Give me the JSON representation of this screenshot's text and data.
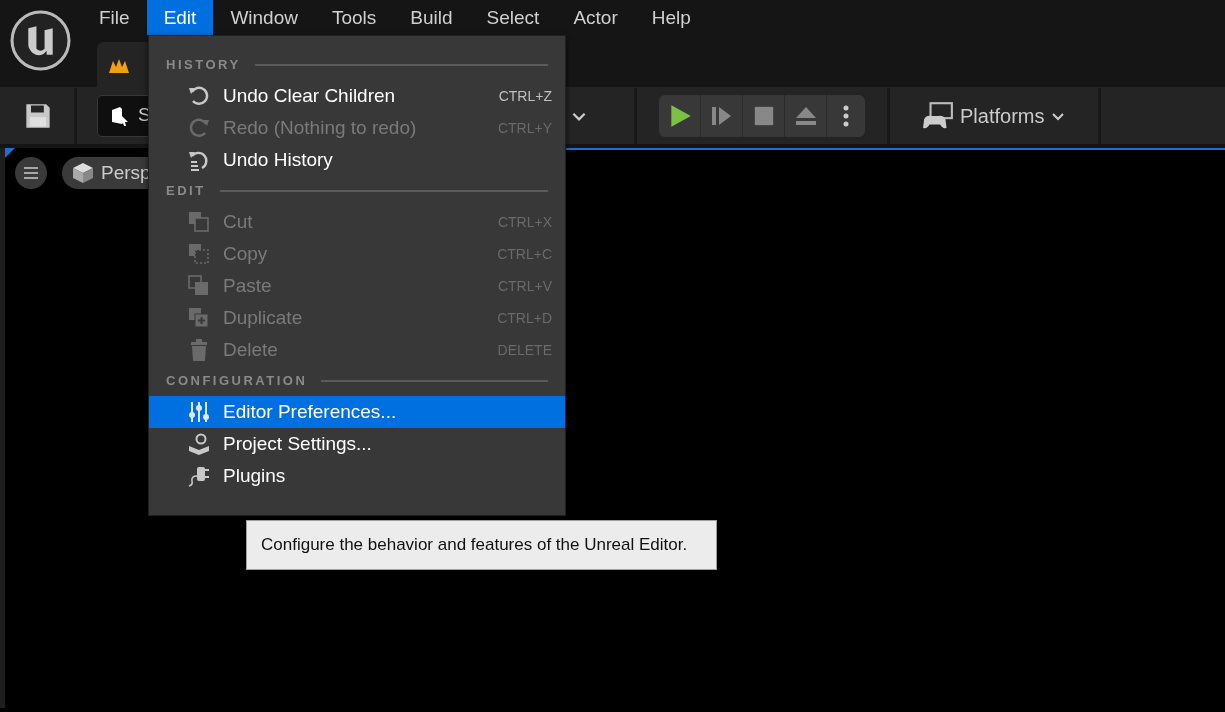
{
  "menubar": {
    "items": [
      {
        "label": "File",
        "selected": false
      },
      {
        "label": "Edit",
        "selected": true
      },
      {
        "label": "Window",
        "selected": false
      },
      {
        "label": "Tools",
        "selected": false
      },
      {
        "label": "Build",
        "selected": false
      },
      {
        "label": "Select",
        "selected": false
      },
      {
        "label": "Actor",
        "selected": false
      },
      {
        "label": "Help",
        "selected": false
      }
    ]
  },
  "toolbar": {
    "mode_button": {
      "label": "S"
    },
    "platforms": {
      "label": "Platforms"
    }
  },
  "viewport": {
    "view_mode": "Persp"
  },
  "edit_menu": {
    "sections": [
      {
        "title": "HISTORY",
        "items": [
          {
            "label": "Undo Clear Children",
            "shortcut": "CTRL+Z",
            "disabled": false,
            "selected": false
          },
          {
            "label": "Redo (Nothing to redo)",
            "shortcut": "CTRL+Y",
            "disabled": true,
            "selected": false
          },
          {
            "label": "Undo History",
            "disabled": false,
            "selected": false
          }
        ]
      },
      {
        "title": "EDIT",
        "items": [
          {
            "label": "Cut",
            "shortcut": "CTRL+X",
            "disabled": true,
            "selected": false
          },
          {
            "label": "Copy",
            "shortcut": "CTRL+C",
            "disabled": true,
            "selected": false
          },
          {
            "label": "Paste",
            "shortcut": "CTRL+V",
            "disabled": true,
            "selected": false
          },
          {
            "label": "Duplicate",
            "shortcut": "CTRL+D",
            "disabled": true,
            "selected": false
          },
          {
            "label": "Delete",
            "shortcut": "DELETE",
            "disabled": true,
            "selected": false
          }
        ]
      },
      {
        "title": "CONFIGURATION",
        "items": [
          {
            "label": "Editor Preferences...",
            "disabled": false,
            "selected": true
          },
          {
            "label": "Project Settings...",
            "disabled": false,
            "selected": false
          },
          {
            "label": "Plugins",
            "disabled": false,
            "selected": false
          }
        ]
      }
    ]
  },
  "tooltip": {
    "text": "Configure the behavior and features of the Unreal Editor."
  }
}
